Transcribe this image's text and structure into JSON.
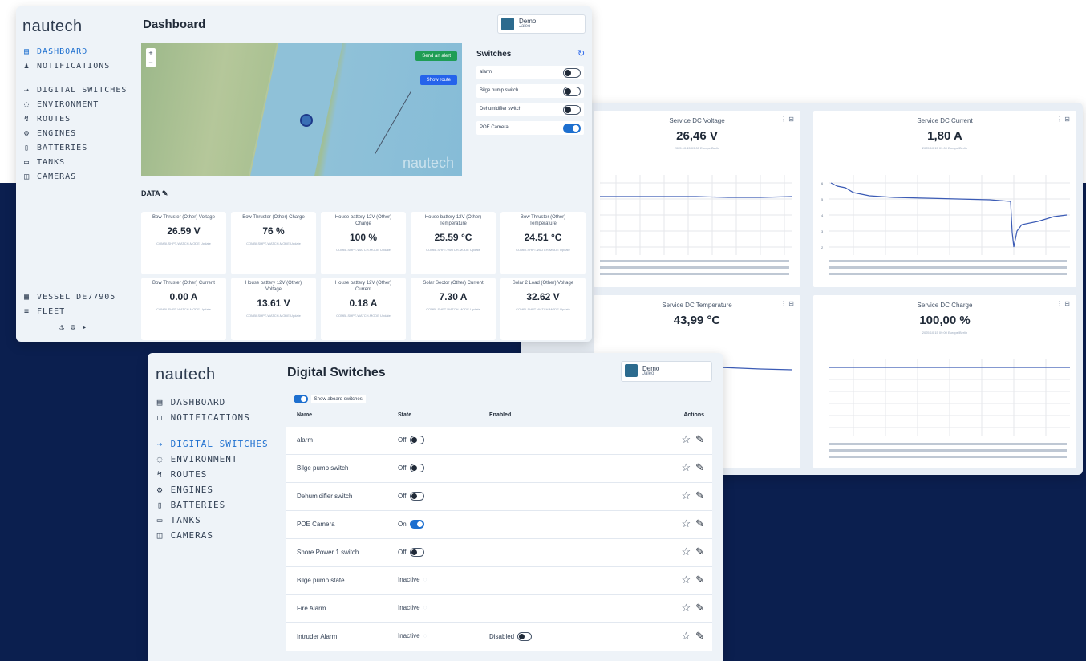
{
  "brand": "nautech",
  "user": {
    "name": "Demo",
    "role": "Jaleo"
  },
  "dashboard": {
    "title": "Dashboard",
    "nav": [
      {
        "icon": "▤",
        "label": "DASHBOARD"
      },
      {
        "icon": "♟",
        "label": "NOTIFICATIONS"
      },
      {
        "icon": "⇢",
        "label": "DIGITAL SWITCHES"
      },
      {
        "icon": "◌",
        "label": "ENVIRONMENT"
      },
      {
        "icon": "↯",
        "label": "ROUTES"
      },
      {
        "icon": "⚙",
        "label": "ENGINES"
      },
      {
        "icon": "▯",
        "label": "BATTERIES"
      },
      {
        "icon": "▭",
        "label": "TANKS"
      },
      {
        "icon": "◫",
        "label": "CAMERAS"
      }
    ],
    "nav_bottom": [
      {
        "icon": "▦",
        "label": "VESSEL DE77905"
      },
      {
        "icon": "≡",
        "label": "FLEET"
      }
    ],
    "map": {
      "btn_primary": "Send an alert",
      "btn_secondary": "Show route",
      "zoom_in": "+",
      "zoom_out": "−",
      "watermark": "nautech"
    },
    "switches": {
      "title": "Switches",
      "items": [
        {
          "label": "alarm",
          "on": false
        },
        {
          "label": "Bilge pump switch",
          "on": false
        },
        {
          "label": "Dehumidifier switch",
          "on": false
        },
        {
          "label": "POE Camera",
          "on": true
        }
      ]
    },
    "data_section": "DATA",
    "tiles": [
      {
        "title": "Bow Thruster (Other) Voltage",
        "value": "26.59 V",
        "sub": "COMBI-SHPT-WATCH-MODE Update"
      },
      {
        "title": "Bow Thruster (Other) Charge",
        "value": "76 %",
        "sub": "COMBI-SHPT-WATCH-MODE Update"
      },
      {
        "title": "House battery 12V (Other) Charge",
        "value": "100 %",
        "sub": "COMBI-SHPT-WATCH-MODE Update"
      },
      {
        "title": "House battery 12V (Other) Temperature",
        "value": "25.59 °C",
        "sub": "COMBI-SHPT-WATCH-MODE Update"
      },
      {
        "title": "Bow Thruster (Other) Temperature",
        "value": "24.51 °C",
        "sub": "COMBI-SHPT-WATCH-MODE Update"
      },
      {
        "title": "Bow Thruster (Other) Current",
        "value": "0.00 A",
        "sub": "COMBI-SHPT-WATCH-MODE Update"
      },
      {
        "title": "House battery 12V (Other) Voltage",
        "value": "13.61 V",
        "sub": "COMBI-SHPT-WATCH-MODE Update"
      },
      {
        "title": "House battery 12V (Other) Current",
        "value": "0.18 A",
        "sub": "COMBI-SHPT-WATCH-MODE Update"
      },
      {
        "title": "Solar Sector (Other) Current",
        "value": "7.30 A",
        "sub": "COMBI-SHPT-WATCH-MODE Update"
      },
      {
        "title": "Solar 2 Load (Other) Voltage",
        "value": "32.62 V",
        "sub": "COMBI-SHPT-WATCH-MODE Update"
      }
    ],
    "footer_icons": "⚓ ⚙ ▸"
  },
  "charts_panel": {
    "charts": [
      {
        "title": "Service DC Voltage",
        "value": "26,46 V",
        "sub": "2025.10.15 09:00 Europe/Berlin",
        "icons": "⋮ ⊟"
      },
      {
        "title": "Service DC Current",
        "value": "1,80 A",
        "sub": "2025.10.15 09:00 Europe/Berlin",
        "icons": "⋮ ⊟"
      },
      {
        "title": "Service DC Temperature",
        "value": "43,99 °C",
        "sub": "",
        "icons": "⋮ ⊟"
      },
      {
        "title": "Service DC Charge",
        "value": "100,00 %",
        "sub": "2025.10.15 09:00 Europe/Berlin",
        "icons": "⋮ ⊟"
      }
    ]
  },
  "switches_page": {
    "title": "Digital Switches",
    "nav": [
      {
        "icon": "▤",
        "label": "DASHBOARD"
      },
      {
        "icon": "◻",
        "label": "NOTIFICATIONS"
      },
      {
        "icon": "⇢",
        "label": "DIGITAL SWITCHES"
      },
      {
        "icon": "◌",
        "label": "ENVIRONMENT"
      },
      {
        "icon": "↯",
        "label": "ROUTES"
      },
      {
        "icon": "⚙",
        "label": "ENGINES"
      },
      {
        "icon": "▯",
        "label": "BATTERIES"
      },
      {
        "icon": "▭",
        "label": "TANKS"
      },
      {
        "icon": "◫",
        "label": "CAMERAS"
      }
    ],
    "show_label": "Show aboard switches",
    "columns": [
      "Name",
      "State",
      "Enabled",
      "Actions"
    ],
    "rows": [
      {
        "name": "alarm",
        "state": "Off",
        "on": false,
        "kind": "toggle",
        "enabled": ""
      },
      {
        "name": "Bilge pump switch",
        "state": "Off",
        "on": false,
        "kind": "toggle",
        "enabled": ""
      },
      {
        "name": "Dehumidifier switch",
        "state": "Off",
        "on": false,
        "kind": "toggle",
        "enabled": ""
      },
      {
        "name": "POE Camera",
        "state": "On",
        "on": true,
        "kind": "toggle",
        "enabled": ""
      },
      {
        "name": "Shore Power 1 switch",
        "state": "Off",
        "on": false,
        "kind": "toggle",
        "enabled": ""
      },
      {
        "name": "Bilge pump state",
        "state": "Inactive",
        "on": false,
        "kind": "state",
        "enabled": ""
      },
      {
        "name": "Fire Alarm",
        "state": "Inactive",
        "on": false,
        "kind": "state",
        "enabled": ""
      },
      {
        "name": "Intruder Alarm",
        "state": "Inactive",
        "on": false,
        "kind": "state",
        "enabled": "Disabled"
      }
    ]
  }
}
